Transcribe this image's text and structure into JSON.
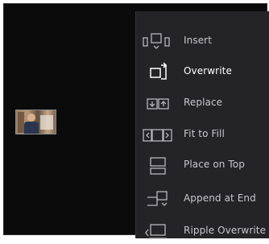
{
  "menu": {
    "items": [
      {
        "id": "insert",
        "label": "Insert",
        "icon": "insert-icon",
        "selected": false
      },
      {
        "id": "overwrite",
        "label": "Overwrite",
        "icon": "overwrite-icon",
        "selected": true
      },
      {
        "id": "replace",
        "label": "Replace",
        "icon": "replace-icon",
        "selected": false
      },
      {
        "id": "fit-to-fill",
        "label": "Fit to Fill",
        "icon": "fit-to-fill-icon",
        "selected": false
      },
      {
        "id": "place-on-top",
        "label": "Place on Top",
        "icon": "place-on-top-icon",
        "selected": false
      },
      {
        "id": "append-at-end",
        "label": "Append at End",
        "icon": "append-at-end-icon",
        "selected": false
      },
      {
        "id": "ripple-overwrite",
        "label": "Ripple Overwrite",
        "icon": "ripple-overwrite-icon",
        "selected": false
      }
    ]
  },
  "colors": {
    "viewer_bg": "#0b0b0c",
    "menu_bg": "#242427",
    "label_text": "#c8c8cc",
    "label_selected": "#ffffff",
    "icon_stroke": "#b8b8bc"
  }
}
